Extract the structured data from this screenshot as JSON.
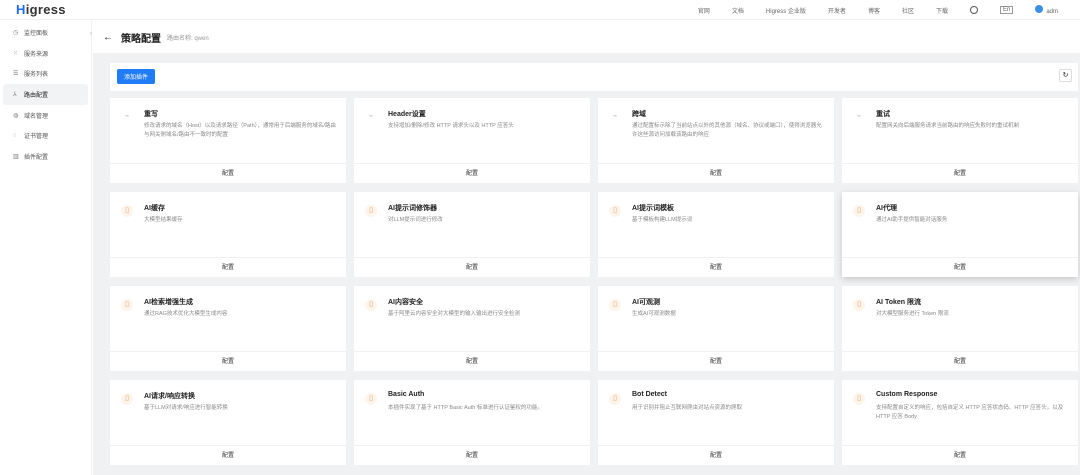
{
  "app": {
    "logo_h": "H",
    "logo_rest": "igress"
  },
  "topnav": [
    "官网",
    "文档",
    "Higress 企业版",
    "开发者",
    "博客",
    "社区",
    "下载"
  ],
  "lang": "En",
  "user": "adm",
  "sidebar": [
    {
      "icon": "◷",
      "label": "监控面板"
    },
    {
      "icon": "⁙",
      "label": "服务来源"
    },
    {
      "icon": "☰",
      "label": "服务列表"
    },
    {
      "icon": "⅄",
      "label": "路由配置",
      "active": true
    },
    {
      "icon": "◍",
      "label": "域名管理"
    },
    {
      "icon": "◌",
      "label": "证书管理"
    },
    {
      "icon": "▥",
      "label": "插件配置"
    }
  ],
  "header": {
    "title": "策略配置",
    "route_label": "路由名称: qwen"
  },
  "toolbar": {
    "add_label": "添加插件",
    "refresh_icon": "↻"
  },
  "footer_label": "配置",
  "cards": [
    {
      "title": "重写",
      "desc": "修改请求的域名（Host）以及请求路径（Path），通常用于后端服务的域名/路由与网关侧域名/路由不一致时的配置",
      "icon": "plug"
    },
    {
      "title": "Header设置",
      "desc": "支持增加/删除/修改 HTTP 请求头以及 HTTP 应答头",
      "icon": "plug"
    },
    {
      "title": "跨域",
      "desc": "通过配置标示除了当前站点以外的其他源（域名、协议或端口），使得浏览器允许这些源访问加载该路由的响应",
      "icon": "plug"
    },
    {
      "title": "重试",
      "desc": "配置网关向后端服务请求当前路由的响应失败时的重试机制",
      "icon": "plug"
    },
    {
      "title": "AI缓存",
      "desc": "大模型结果缓存",
      "icon": "ai"
    },
    {
      "title": "AI提示词修饰器",
      "desc": "对LLM提示词进行修改",
      "icon": "ai"
    },
    {
      "title": "AI提示词模板",
      "desc": "基于模板构建LLM提示词",
      "icon": "ai"
    },
    {
      "title": "AI代理",
      "desc": "通过AI助手提供智能对话服务",
      "icon": "ai",
      "hover": true
    },
    {
      "title": "AI检索增强生成",
      "desc": "通过RAG技术优化大模型生成内容",
      "icon": "ai"
    },
    {
      "title": "AI内容安全",
      "desc": "基于阿里云内容安全对大模型的输入输出进行安全检测",
      "icon": "ai"
    },
    {
      "title": "AI可观测",
      "desc": "生成AI可观测数据",
      "icon": "ai"
    },
    {
      "title": "AI Token 限流",
      "desc": "对大模型服务进行 Token 限流",
      "icon": "ai"
    },
    {
      "title": "AI请求/响应转换",
      "desc": "基于LLM对请求/响应进行智能转换",
      "icon": "ai"
    },
    {
      "title": "Basic Auth",
      "desc": "本插件实现了基于 HTTP Basic Auth 标准进行认证鉴权的功能。",
      "icon": "ai"
    },
    {
      "title": "Bot Detect",
      "desc": "用于识别并阻止互联网爬虫对站点资源的爬取",
      "icon": "ai"
    },
    {
      "title": "Custom Response",
      "desc": "支持配置自定义的响应，包括自定义 HTTP 应答状态码、HTTP 应答头，以及 HTTP 应答 Body",
      "icon": "ai"
    }
  ]
}
